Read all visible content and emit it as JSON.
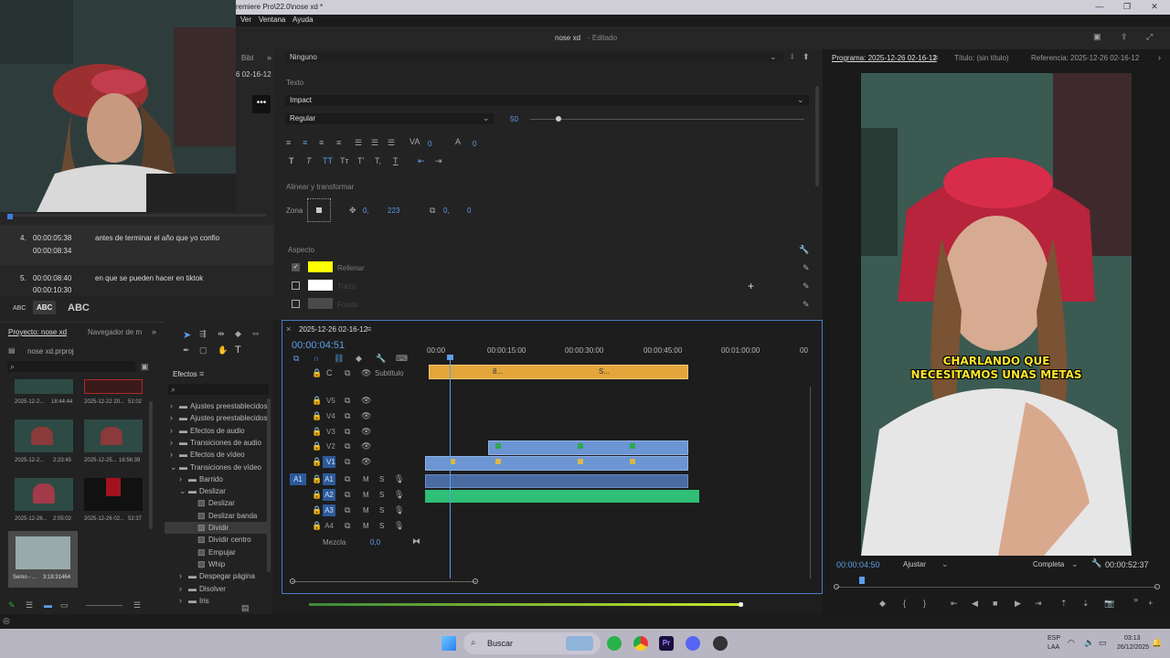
{
  "window": {
    "title": "remiere Pro\\22.0\\nose xd *",
    "menu": [
      "Ver",
      "Ventana",
      "Ayuda"
    ],
    "doc_title": "nose xd",
    "doc_state": "- Editado"
  },
  "captions": {
    "bib_tab": "Bibl",
    "date": "6 02-16-12",
    "rows": [
      {
        "num": "4.",
        "start": "00:00:05:38",
        "end": "00:00:08:34",
        "text": "antes de terminar el año que yo confio"
      },
      {
        "num": "5.",
        "start": "00:00:08:40",
        "end": "00:00:10:30",
        "text": "en que se pueden hacer en tiktok"
      }
    ],
    "abc_labels": [
      "ABC",
      "ABC",
      "ABC"
    ]
  },
  "egfx": {
    "style_select": "Ninguno",
    "section_text": "Texto",
    "font": "Impact",
    "font_style": "Regular",
    "font_size": "50",
    "tracking": "0",
    "kerning": "0",
    "section_align": "Alinear y transformar",
    "zona_label": "Zona",
    "pos_x": "0,",
    "pos_y": "223",
    "rot_a": "0,",
    "rot_b": "0",
    "section_aspect": "Aspecto",
    "fill_label": "Rellenar",
    "fill_color": "#ffff00",
    "stroke_label": "Trazo",
    "stroke_color": "#ffffff",
    "bg_label": "Fondo"
  },
  "project": {
    "tab_project": "Proyecto: nose xd",
    "tab_media": "Navegador de m",
    "file": "nose xd.prproj",
    "thumbs": [
      {
        "name": "2025-12-2...",
        "dur": "18:44:44"
      },
      {
        "name": "2025-12-22 20...",
        "dur": "51:02"
      },
      {
        "name": "2025-12-2...",
        "dur": "2:23:45"
      },
      {
        "name": "2025-12-25...",
        "dur": "16:56:39"
      },
      {
        "name": "2025-12-26...",
        "dur": "2:05:02"
      },
      {
        "name": "2025-12-26 02...",
        "dur": "52:37"
      },
      {
        "name": "Semo - ...",
        "dur": "3:18:31464"
      }
    ]
  },
  "effects": {
    "tab": "Efectos",
    "items": [
      {
        "label": "Ajustes preestablecidos",
        "depth": 0,
        "open": false
      },
      {
        "label": "Ajustes preestablecidos",
        "depth": 0,
        "open": false
      },
      {
        "label": "Efectos de audio",
        "depth": 0,
        "open": false
      },
      {
        "label": "Transiciones de audio",
        "depth": 0,
        "open": false
      },
      {
        "label": "Efectos de vídeo",
        "depth": 0,
        "open": false
      },
      {
        "label": "Transiciones de vídeo",
        "depth": 0,
        "open": true
      },
      {
        "label": "Barrido",
        "depth": 1,
        "open": false
      },
      {
        "label": "Deslizar",
        "depth": 1,
        "open": true
      },
      {
        "label": "Deslizar",
        "depth": 2,
        "open": false
      },
      {
        "label": "Deslizar banda",
        "depth": 2,
        "open": false
      },
      {
        "label": "Dividir",
        "depth": 2,
        "open": false,
        "selected": true
      },
      {
        "label": "Dividir centro",
        "depth": 2,
        "open": false
      },
      {
        "label": "Empujar",
        "depth": 2,
        "open": false
      },
      {
        "label": "Whip",
        "depth": 2,
        "open": false
      },
      {
        "label": "Despegar página",
        "depth": 1,
        "open": false
      },
      {
        "label": "Disolver",
        "depth": 1,
        "open": false
      },
      {
        "label": "Iris",
        "depth": 1,
        "open": false
      }
    ]
  },
  "timeline": {
    "sequence": "2025-12-26 02-16-12",
    "timecode": "00:00:04:51",
    "ruler": [
      "00:00",
      "00:00:15:00",
      "00:00:30:00",
      "00:00:45:00",
      "00:01:00:00",
      "00"
    ],
    "subtitle_track": "Subtítulo",
    "video_tracks": [
      "V5",
      "V4",
      "V3",
      "V2",
      "V1"
    ],
    "audio_tracks": [
      "A1",
      "A2",
      "A3",
      "A4"
    ],
    "mix_label": "Mezcla",
    "mix_value": "0,0",
    "caption_clip_labels": [
      "8...",
      "S..."
    ]
  },
  "program": {
    "tab_program": "Programa: 2025-12-26 02-16-12",
    "tab_title": "Título: (sin título)",
    "tab_ref": "Referencia: 2025-12-26 02-16-12",
    "caption": "CHARLANDO QUE NECESITAMOS UNAS METAS",
    "timecode": "00:00:04:50",
    "fit": "Ajustar",
    "quality": "Completa",
    "duration": "00:00:52:37"
  },
  "taskbar": {
    "search": "Buscar",
    "lang_top": "ESP",
    "lang_bottom": "LAA",
    "time": "03:13",
    "date": "26/12/2025"
  }
}
